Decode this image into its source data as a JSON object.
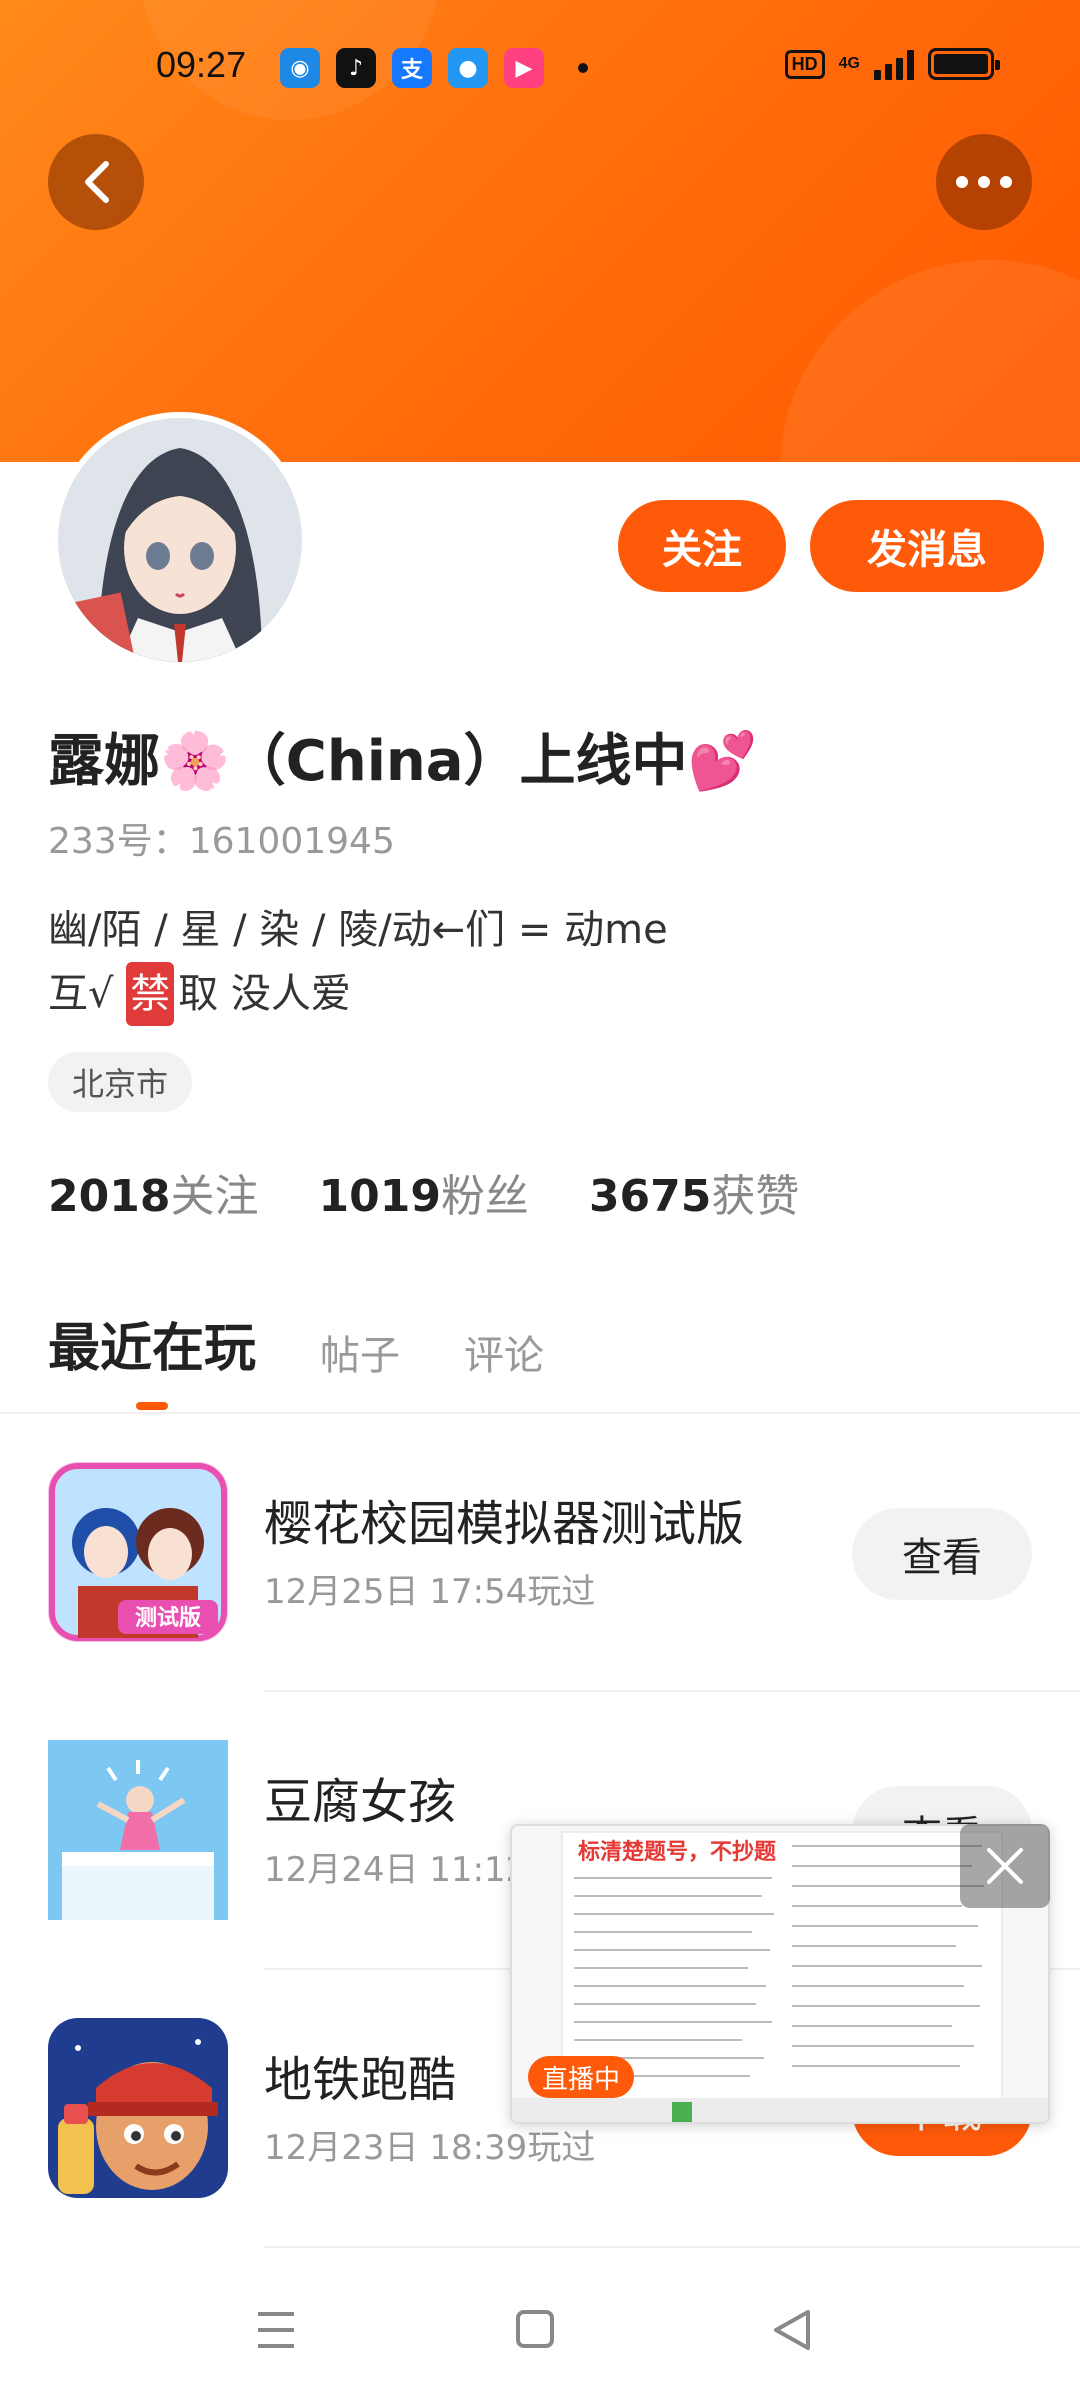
{
  "status_bar": {
    "time": "09:27",
    "hd_label": "HD",
    "network_label": "4G",
    "app_icons": [
      {
        "name": "browser-icon",
        "color": "#1e88e5",
        "glyph": "◉"
      },
      {
        "name": "tiktok-icon",
        "color": "#111111",
        "glyph": "♪"
      },
      {
        "name": "alipay-icon",
        "color": "#1677ff",
        "glyph": "支"
      },
      {
        "name": "qq-browser-icon",
        "color": "#2196f3",
        "glyph": "●"
      },
      {
        "name": "video-app-icon",
        "color": "#ff4081",
        "glyph": "▶"
      }
    ]
  },
  "header": {
    "accent_color": "#ff5a0a"
  },
  "profile": {
    "name": "露娜🌸（China）上线中💕",
    "uid": "233号：161001945",
    "bio_line1": "幽/陌 / 星 / 染 / 陵/动←们 = 动me",
    "bio_line2_prefix": "互√ ",
    "bio_line2_ban": "禁",
    "bio_line2_suffix": "取 没人爱",
    "location": "北京市",
    "follow_label": "关注",
    "message_label": "发消息"
  },
  "stats": [
    {
      "value": "2018",
      "label": "关注"
    },
    {
      "value": "1019",
      "label": "粉丝"
    },
    {
      "value": "3675",
      "label": "获赞"
    }
  ],
  "tabs": [
    "最近在玩",
    "帖子",
    "评论"
  ],
  "games": [
    {
      "title": "樱花校园模拟器测试版",
      "played": "12月25日 17:54玩过",
      "action": "查看"
    },
    {
      "title": "豆腐女孩",
      "played": "12月24日 11:12",
      "action": "查看"
    },
    {
      "title": "地铁跑酷",
      "played": "12月23日 18:39玩过",
      "action": "下载"
    }
  ],
  "pip": {
    "title": "标清楚题号，不抄题",
    "live_badge": "直播中"
  }
}
